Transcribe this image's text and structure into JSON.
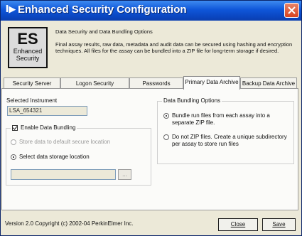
{
  "window": {
    "title": "Enhanced Security Configuration",
    "app_icon_glyph": "I▶",
    "close_icon": "close-icon"
  },
  "header": {
    "logo_big": "ES",
    "logo_small_1": "Enhanced",
    "logo_small_2": "Security",
    "title": "Data Security and Data Bundling Options",
    "description": "Final assay results, raw data, metadata and audit data can be secured using hashing and encryption techniques.  All files for the assay can be bundled into a ZIP file for long-term storage if desired."
  },
  "tabs": [
    {
      "label": "Security Server"
    },
    {
      "label": "Logon Security"
    },
    {
      "label": "Passwords"
    },
    {
      "label": "Primary Data Archive"
    },
    {
      "label": "Backup Data Archive"
    }
  ],
  "active_tab": "Primary Data Archive",
  "archive": {
    "selected_instrument_label": "Selected Instrument",
    "selected_instrument_value": "LSA_654321",
    "enable_bundling_label": "Enable Data Bundling",
    "enable_bundling_checked": true,
    "store_default_label": "Store data to default secure location",
    "select_location_label": "Select data storage location",
    "storage_location_value": "",
    "browse_label": "..."
  },
  "bundling": {
    "legend": "Data Bundling Options",
    "option1_line1": "Bundle run files from each assay into a",
    "option1_line2": "separate ZIP file.",
    "option2_line1": "Do not ZIP files.  Create a unique subdirectory",
    "option2_line2": "per assay to store run files"
  },
  "footer": {
    "version": "Version 2.0 Copyright (c) 2002-04 PerkinElmer Inc.",
    "close_label": "Close",
    "save_label": "Save"
  },
  "colors": {
    "titlebar": "#0f56d9",
    "window_bg": "#ece9d8",
    "close_button": "#d9431e"
  }
}
